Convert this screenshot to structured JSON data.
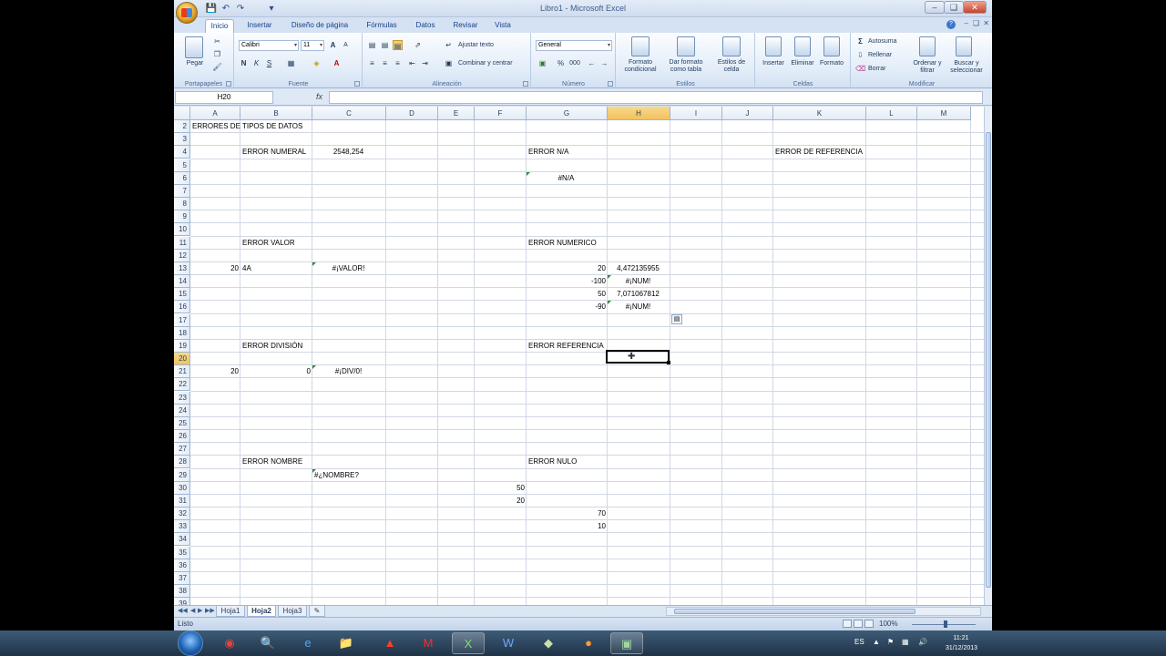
{
  "window": {
    "title": "Libro1 - Microsoft Excel"
  },
  "ribbon_tabs": [
    "Inicio",
    "Insertar",
    "Diseño de página",
    "Fórmulas",
    "Datos",
    "Revisar",
    "Vista"
  ],
  "ribbon": {
    "clipboard": {
      "paste_label": "Pegar",
      "group_label": "Portapapeles"
    },
    "font": {
      "font_name": "Calibri",
      "font_size": "11",
      "bold": "N",
      "italic": "K",
      "underline": "S",
      "group_label": "Fuente"
    },
    "alignment": {
      "wrap_text": "Ajustar texto",
      "merge_center": "Combinar y centrar",
      "group_label": "Alineación"
    },
    "number": {
      "format": "General",
      "percent": "%",
      "thousands": "000",
      "group_label": "Número"
    },
    "styles": {
      "conditional": "Formato condicional",
      "as_table": "Dar formato como tabla",
      "cell_styles": "Estilos de celda",
      "group_label": "Estilos"
    },
    "cells": {
      "insert": "Insertar",
      "delete": "Eliminar",
      "format": "Formato",
      "group_label": "Celdas"
    },
    "editing": {
      "autosum": "Autosuma",
      "fill": "Rellenar",
      "clear": "Borrar",
      "sort_filter": "Ordenar y filtrar",
      "find_select": "Buscar y seleccionar",
      "group_label": "Modificar"
    }
  },
  "formula_bar": {
    "name_box": "H20",
    "fx": "fx",
    "formula": ""
  },
  "columns": [
    "A",
    "B",
    "C",
    "D",
    "E",
    "F",
    "G",
    "H",
    "I",
    "J",
    "K",
    "L",
    "M"
  ],
  "selected_column": "H",
  "rows": [
    "2",
    "3",
    "4",
    "5",
    "6",
    "7",
    "8",
    "9",
    "10",
    "11",
    "12",
    "13",
    "14",
    "15",
    "16",
    "17",
    "18",
    "19",
    "20",
    "21",
    "22",
    "23",
    "24",
    "25",
    "26",
    "27",
    "28",
    "29",
    "30",
    "31",
    "32",
    "33",
    "34",
    "35",
    "36",
    "37",
    "38",
    "39"
  ],
  "selected_row": "20",
  "cells": [
    {
      "ref": "A2",
      "value": "ERRORES DE TIPOS DE DATOS",
      "align": "left"
    },
    {
      "ref": "B4",
      "value": "ERROR NUMERAL",
      "align": "left"
    },
    {
      "ref": "C4",
      "value": "2548,254",
      "align": "center"
    },
    {
      "ref": "G4",
      "value": "ERROR N/A",
      "align": "left"
    },
    {
      "ref": "K4",
      "value": "ERROR DE REFERENCIA",
      "align": "left"
    },
    {
      "ref": "G6",
      "value": "#N/A",
      "align": "center",
      "flag": true
    },
    {
      "ref": "B11",
      "value": "ERROR VALOR",
      "align": "left"
    },
    {
      "ref": "G11",
      "value": "ERROR NUMERICO",
      "align": "left"
    },
    {
      "ref": "A13",
      "value": "20",
      "align": "right"
    },
    {
      "ref": "B13",
      "value": "4A",
      "align": "left"
    },
    {
      "ref": "C13",
      "value": "#¡VALOR!",
      "align": "center",
      "flag": true
    },
    {
      "ref": "G13",
      "value": "20",
      "align": "right"
    },
    {
      "ref": "H13",
      "value": "4,472135955",
      "align": "center"
    },
    {
      "ref": "G14",
      "value": "-100",
      "align": "right"
    },
    {
      "ref": "H14",
      "value": "#¡NUM!",
      "align": "center",
      "flag": true
    },
    {
      "ref": "G15",
      "value": "50",
      "align": "right"
    },
    {
      "ref": "H15",
      "value": "7,071067812",
      "align": "center"
    },
    {
      "ref": "G16",
      "value": "-90",
      "align": "right"
    },
    {
      "ref": "H16",
      "value": "#¡NUM!",
      "align": "center",
      "flag": true
    },
    {
      "ref": "B19",
      "value": "ERROR DIVISIÓN",
      "align": "left"
    },
    {
      "ref": "G19",
      "value": "ERROR REFERENCIA",
      "align": "left"
    },
    {
      "ref": "A21",
      "value": "20",
      "align": "right"
    },
    {
      "ref": "B21",
      "value": "0",
      "align": "right"
    },
    {
      "ref": "C21",
      "value": "#¡DIV/0!",
      "align": "center",
      "flag": true
    },
    {
      "ref": "B28",
      "value": "ERROR NOMBRE",
      "align": "left"
    },
    {
      "ref": "G28",
      "value": "ERROR NULO",
      "align": "left"
    },
    {
      "ref": "C29",
      "value": "#¿NOMBRE?",
      "align": "left",
      "flag": true
    },
    {
      "ref": "F30",
      "value": "50",
      "align": "right"
    },
    {
      "ref": "F31",
      "value": "20",
      "align": "right"
    },
    {
      "ref": "G32",
      "value": "70",
      "align": "right"
    },
    {
      "ref": "G33",
      "value": "10",
      "align": "right"
    }
  ],
  "sheets": [
    "Hoja1",
    "Hoja2",
    "Hoja3"
  ],
  "active_sheet": "Hoja2",
  "status": {
    "text": "Listo",
    "zoom": "100%"
  },
  "taskbar": {
    "language": "ES",
    "time": "11:21",
    "date": "31/12/2013"
  },
  "colors": {
    "accent": "#15428b",
    "selected_header": "#f1c15f",
    "error_flag": "#2e8b3a"
  }
}
